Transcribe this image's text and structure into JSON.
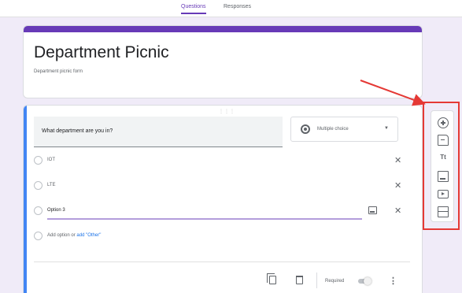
{
  "header": {
    "tabs": [
      {
        "label": "Questions",
        "active": true
      },
      {
        "label": "Responses",
        "active": false
      }
    ]
  },
  "form": {
    "title": "Department Picnic",
    "description": "Department picnic form"
  },
  "question": {
    "text": "What department are you in?",
    "type_label": "Multiple choice",
    "type_icon": "radio-button-icon",
    "options": [
      {
        "label": "IOT"
      },
      {
        "label": "LTE"
      },
      {
        "label": "Option 3"
      }
    ],
    "add_option_label": "Add option",
    "or_label": "or",
    "add_other_label": "add \"Other\"",
    "required_label": "Required",
    "required_on": false
  },
  "toolbar": {
    "items": [
      {
        "name": "add-question-icon"
      },
      {
        "name": "import-questions-icon"
      },
      {
        "name": "add-title-icon",
        "glyph": "Tt"
      },
      {
        "name": "add-image-icon"
      },
      {
        "name": "add-video-icon"
      },
      {
        "name": "add-section-icon"
      }
    ]
  },
  "colors": {
    "brand": "#673ab7",
    "accent": "#4285f4",
    "annotation": "#e53935",
    "background": "#f0ebf8"
  }
}
